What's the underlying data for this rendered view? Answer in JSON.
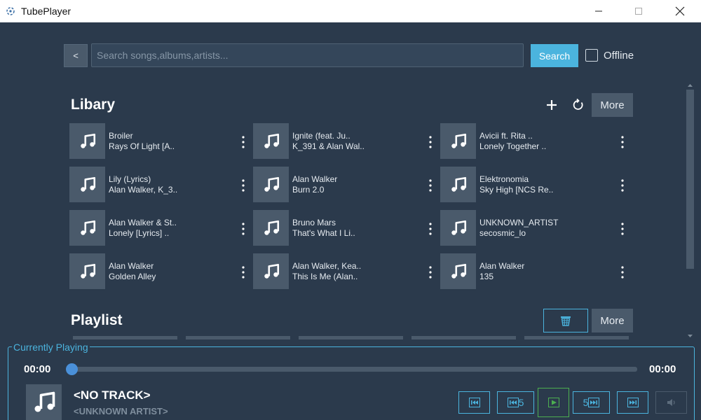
{
  "window": {
    "title": "TubePlayer"
  },
  "search": {
    "back_label": "<",
    "placeholder": "Search songs,albums,artists...",
    "value": "",
    "button_label": "Search",
    "offline_label": "Offline",
    "offline_checked": false
  },
  "library": {
    "title": "Libary",
    "more_label": "More",
    "items": [
      {
        "title": "Broiler",
        "artist": "Rays Of Light [A.."
      },
      {
        "title": "Ignite (feat. Ju..",
        "artist": "K_391 & Alan Wal.."
      },
      {
        "title": "Avicii ft. Rita ..",
        "artist": "Lonely Together .."
      },
      {
        "title": "Lily (Lyrics)",
        "artist": "Alan Walker, K_3.."
      },
      {
        "title": "Alan Walker",
        "artist": "Burn 2.0"
      },
      {
        "title": "Elektronomia",
        "artist": "Sky High [NCS Re.."
      },
      {
        "title": "Alan Walker & St..",
        "artist": "Lonely [Lyrics] .."
      },
      {
        "title": "Bruno Mars",
        "artist": "That's What I Li.."
      },
      {
        "title": "UNKNOWN_ARTIST",
        "artist": "secosmic_lo"
      },
      {
        "title": "Alan Walker",
        "artist": "Golden Alley"
      },
      {
        "title": "Alan Walker, Kea..",
        "artist": "This Is Me (Alan.."
      },
      {
        "title": "Alan Walker",
        "artist": "135"
      }
    ]
  },
  "playlist": {
    "title": "Playlist",
    "more_label": "More"
  },
  "player": {
    "legend": "Currently Playing",
    "time_current": "00:00",
    "time_total": "00:00",
    "progress": 0,
    "track_title": "<NO TRACK>",
    "track_artist": "<UNKNOWN ARTIST>",
    "skip_back_label": "5",
    "skip_forward_label": "5"
  },
  "colors": {
    "accent": "#4bb4de",
    "play": "#4caf50",
    "background": "#2b3a4c",
    "panel": "#4a5a6b",
    "progress": "#4a90d9"
  }
}
